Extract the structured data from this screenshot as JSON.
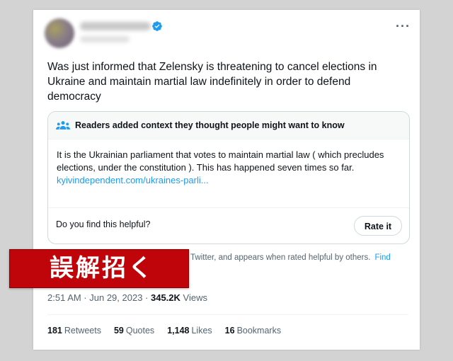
{
  "tweet": {
    "text": "Was just informed that Zelensky is threatening to cancel elections in Ukraine and maintain martial law indefinitely in order to defend democracy",
    "more_icon": "more-horizontal-icon",
    "verified_icon": "verified-badge-icon"
  },
  "note": {
    "title": "Readers added context they thought people might want to know",
    "body": "It is the Ukrainian parliament that votes to maintain martial law ( which precludes elections, under the constitution ). This has happened seven times so far.",
    "link": "kyivindependent.com/ukraines-parli...",
    "helpful_question": "Do you find this helpful?",
    "rate_button": "Rate it",
    "icon": "people-icon"
  },
  "context_line": {
    "text": "Twitter, and appears when rated helpful by others.",
    "link": "Find"
  },
  "meta": {
    "time": "2:51 AM · Jun 29, 2023 · ",
    "views_count": "345.2K",
    "views_label": " Views"
  },
  "stats": [
    {
      "count": "181",
      "label": "Retweets"
    },
    {
      "count": "59",
      "label": "Quotes"
    },
    {
      "count": "1,148",
      "label": "Likes"
    },
    {
      "count": "16",
      "label": "Bookmarks"
    }
  ],
  "banner": {
    "text": "誤解招く"
  },
  "colors": {
    "accent": "#1d9bf0",
    "banner": "#c0050a",
    "text": "#0f1419",
    "muted": "#536471"
  }
}
